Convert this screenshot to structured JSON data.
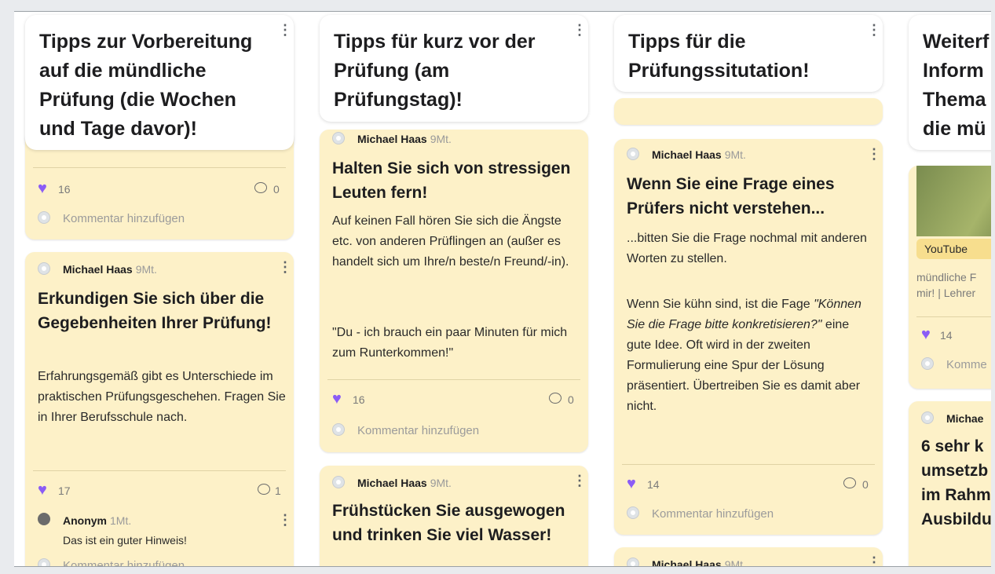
{
  "columns": [
    {
      "header": "Tipps zur Vorbereitung auf die mündliche Prüfung (die Wochen und Tage davor)!",
      "partial_card": {
        "likes": "16",
        "comments": "0",
        "add_comment": "Kommentar hinzufügen"
      },
      "card": {
        "author": "Michael Haas",
        "ago": "9Mt.",
        "title": "Erkundigen Sie sich über die Gegebenheiten Ihrer Prüfung!",
        "body": "Erfahrungsgemäß gibt es Unterschiede im praktischen Prüfungsgeschehen. Fragen Sie in Ihrer Berufsschule nach.",
        "likes": "17",
        "comments": "1",
        "reply": {
          "author": "Anonym",
          "ago": "1Mt.",
          "text": "Das ist ein guter Hinweis!"
        },
        "add_comment": "Kommentar hinzufügen"
      }
    },
    {
      "header": "Tipps für kurz vor der Prüfung (am Prüfungstag)!",
      "card1": {
        "author": "Michael Haas",
        "ago": "9Mt.",
        "title": "Halten Sie sich von stressigen Leuten fern!",
        "body1": "Auf keinen Fall hören Sie sich die Ängste etc. von anderen Prüflingen an (außer es handelt sich um Ihre/n beste/n Freund/-in).",
        "body2": "\"Du - ich brauch ein paar Minuten für mich zum Runterkommen!\"",
        "likes": "16",
        "comments": "0",
        "add_comment": "Kommentar hinzufügen"
      },
      "card2": {
        "author": "Michael Haas",
        "ago": "9Mt.",
        "title": "Frühstücken Sie ausgewogen und trinken Sie viel Wasser!"
      }
    },
    {
      "header": "Tipps für die Prüfungssitutation!",
      "card1": {
        "author": "Michael Haas",
        "ago": "9Mt.",
        "title": "Wenn Sie eine Frage eines Prüfers nicht verstehen...",
        "body1": "...bitten Sie die Frage nochmal mit anderen Worten zu stellen.",
        "body2_pre": "Wenn Sie kühn sind, ist die Fage ",
        "body2_quote": "\"Können Sie die Frage bitte konkretisieren?\"",
        "body2_post": " eine gute Idee. Oft wird in der zweiten Formulierung eine Spur der Lösung präsentiert. Übertreiben Sie es damit aber nicht.",
        "likes": "14",
        "comments": "0",
        "add_comment": "Kommentar hinzufügen"
      },
      "card2": {
        "author": "Michael Haas",
        "ago": "9Mt."
      }
    },
    {
      "header": "Weiterf Inform Thema die mü",
      "video_card": {
        "tag": "YouTube",
        "caption1": "mündliche F",
        "caption2": "mir! | Lehrer",
        "likes": "14",
        "add_comment": "Komme"
      },
      "card2": {
        "author": "Michae",
        "title": "6 sehr k umsetzb im Rahm Ausbildu"
      }
    }
  ]
}
